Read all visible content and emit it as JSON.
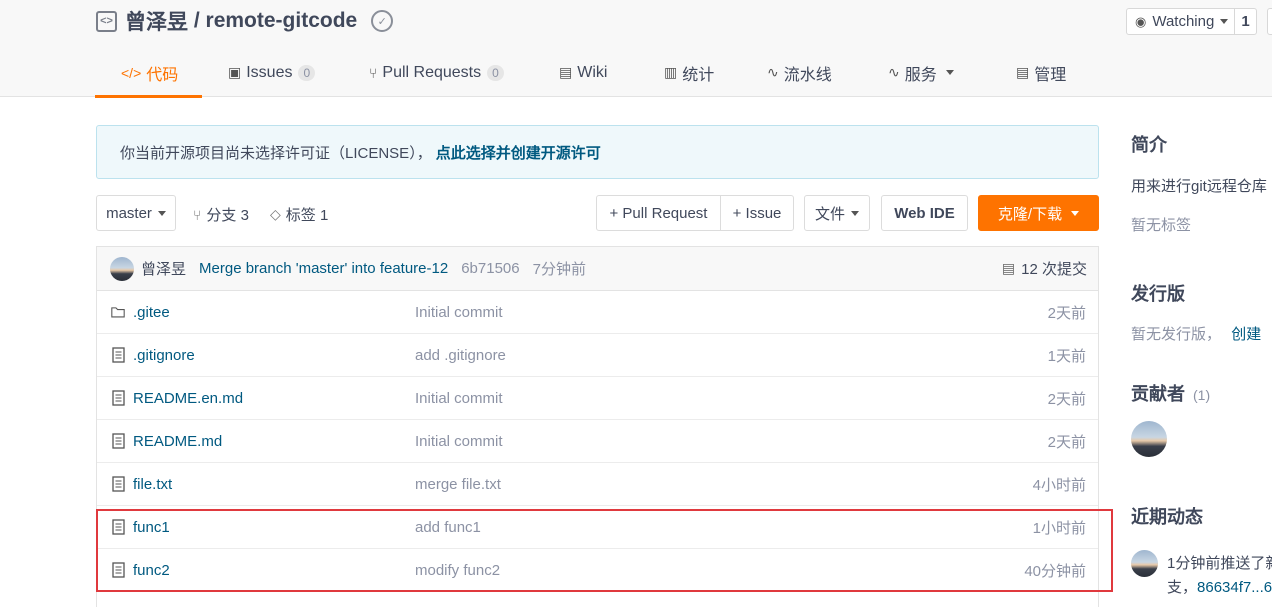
{
  "repo": {
    "owner": "曾泽昱",
    "separator": " / ",
    "name": "remote-gitcode"
  },
  "watch": {
    "label": "Watching",
    "count": "1"
  },
  "tabs": [
    {
      "icon": "</>",
      "label": "代码",
      "count": ""
    },
    {
      "icon": "▣",
      "label": "Issues",
      "count": "0"
    },
    {
      "icon": "⑂",
      "label": "Pull Requests",
      "count": "0"
    },
    {
      "icon": "▤",
      "label": "Wiki",
      "count": ""
    },
    {
      "icon": "▥",
      "label": "统计",
      "count": ""
    },
    {
      "icon": "∿",
      "label": "流水线",
      "count": ""
    },
    {
      "icon": "∿",
      "label": "服务",
      "count": ""
    },
    {
      "icon": "▤",
      "label": "管理",
      "count": ""
    }
  ],
  "notice": {
    "text": "你当前开源项目尚未选择许可证（LICENSE），",
    "link": "点此选择并创建开源许可"
  },
  "toolbar": {
    "branch": "master",
    "branches": "分支 3",
    "tags": "标签 1",
    "pull_request": "+ Pull Request",
    "issue": "+ Issue",
    "file": "文件",
    "web_ide": "Web IDE",
    "clone": "克隆/下载"
  },
  "latest_commit": {
    "author": "曾泽昱",
    "message": "Merge branch 'master' into feature-12",
    "sha": "6b71506",
    "time": "7分钟前",
    "commits": "12 次提交"
  },
  "files": [
    {
      "type": "folder",
      "name": ".gitee",
      "message": "Initial commit",
      "time": "2天前"
    },
    {
      "type": "file",
      "name": ".gitignore",
      "message": "add .gitignore",
      "time": "1天前"
    },
    {
      "type": "file",
      "name": "README.en.md",
      "message": "Initial commit",
      "time": "2天前"
    },
    {
      "type": "file",
      "name": "README.md",
      "message": "Initial commit",
      "time": "2天前"
    },
    {
      "type": "file",
      "name": "file.txt",
      "message": "merge file.txt",
      "time": "4小时前"
    },
    {
      "type": "file",
      "name": "func1",
      "message": "add func1",
      "time": "1小时前"
    },
    {
      "type": "file",
      "name": "func2",
      "message": "modify func2",
      "time": "40分钟前"
    }
  ],
  "sidebar": {
    "intro_title": "简介",
    "intro_text": "用来进行git远程仓库",
    "no_tags": "暂无标签",
    "release_title": "发行版",
    "no_release": "暂无发行版，",
    "create": "创建",
    "contributors_title": "贡献者",
    "contributors_count": "(1)",
    "activity_title": "近期动态",
    "activity_line1": "1分钟前推送了新",
    "activity_line2_prefix": "支，",
    "activity_line2_link": "86634f7...6"
  },
  "colors": {
    "accent": "#fe7300",
    "link": "#005980",
    "highlight": "#e0393e"
  }
}
